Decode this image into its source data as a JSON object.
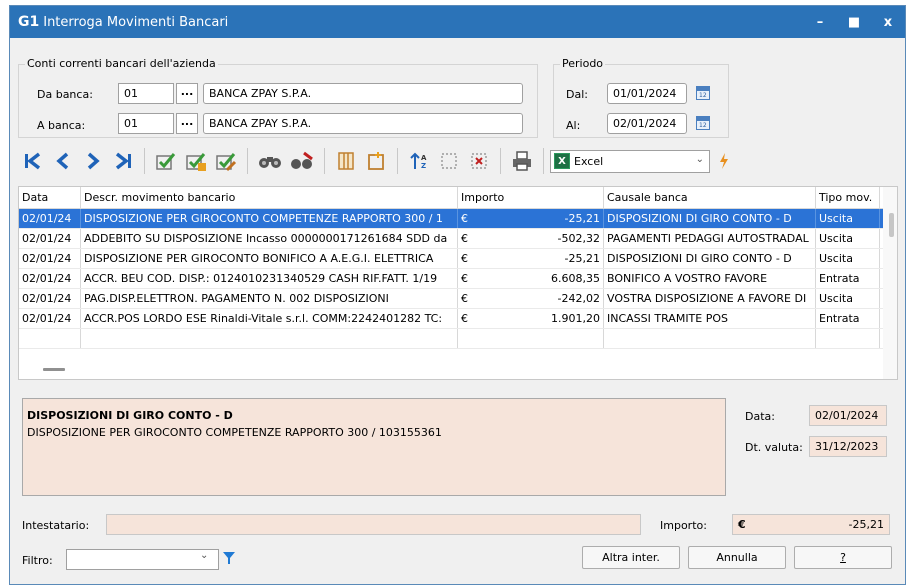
{
  "window": {
    "app_icon": "G1",
    "title": "Interroga Movimenti Bancari",
    "min": "–",
    "max": "■",
    "close": "x"
  },
  "conti": {
    "group_title": "Conti correnti bancari dell'azienda",
    "da_label": "Da banca:",
    "da_code": "01",
    "da_name": "BANCA ZPAY S.P.A.",
    "a_label": "A banca:",
    "a_code": "01",
    "a_name": "BANCA ZPAY S.P.A.",
    "dots": "..."
  },
  "periodo": {
    "group_title": "Periodo",
    "dal_label": "Dal:",
    "dal_value": "01/01/2024",
    "al_label": "Al:",
    "al_value": "02/01/2024",
    "cal_text": "12"
  },
  "toolbar": {
    "export_value": "Excel",
    "export_icon": "excel-icon"
  },
  "grid": {
    "columns": [
      "Data",
      "Descr. movimento bancario",
      "Importo",
      "Causale banca",
      "Tipo mov."
    ],
    "rows": [
      {
        "data": "02/01/24",
        "descr": "DISPOSIZIONE PER GIROCONTO COMPETENZE RAPPORTO 300 / 1",
        "cur": "€",
        "importo": "-25,21",
        "causale": "DISPOSIZIONI DI GIRO CONTO - D",
        "tipo": "Uscita"
      },
      {
        "data": "02/01/24",
        "descr": "ADDEBITO SU DISPOSIZIONE Incasso 0000000171261684 SDD da",
        "cur": "€",
        "importo": "-502,32",
        "causale": "PAGAMENTI PEDAGGI AUTOSTRADAL",
        "tipo": "Uscita"
      },
      {
        "data": "02/01/24",
        "descr": "DISPOSIZIONE PER GIROCONTO BONIFICO A A.E.G.I. ELETTRICA",
        "cur": "€",
        "importo": "-25,21",
        "causale": "DISPOSIZIONI DI GIRO CONTO - D",
        "tipo": "Uscita"
      },
      {
        "data": "02/01/24",
        "descr": "ACCR. BEU COD. DISP.: 0124010231340529 CASH RIF.FATT. 1/19",
        "cur": "€",
        "importo": "6.608,35",
        "causale": "BONIFICO A VOSTRO FAVORE",
        "tipo": "Entrata"
      },
      {
        "data": "02/01/24",
        "descr": "PAG.DISP.ELETTRON. PAGAMENTO N. 002 DISPOSIZIONI",
        "cur": "€",
        "importo": "-242,02",
        "causale": "VOSTRA DISPOSIZIONE A FAVORE DI",
        "tipo": "Uscita"
      },
      {
        "data": "02/01/24",
        "descr": "ACCR.POS LORDO ESE Rinaldi-Vitale s.r.l.  COMM:2242401282 TC:",
        "cur": "€",
        "importo": "1.901,20",
        "causale": "INCASSI TRAMITE POS",
        "tipo": "Entrata"
      }
    ]
  },
  "detail": {
    "title": "DISPOSIZIONI DI GIRO CONTO - D",
    "text": "DISPOSIZIONE PER GIROCONTO COMPETENZE RAPPORTO 300 / 103155361",
    "data_label": "Data:",
    "data_value": "02/01/2024",
    "valuta_label": "Dt. valuta:",
    "valuta_value": "31/12/2023"
  },
  "footer": {
    "intestatario_label": "Intestatario:",
    "intestatario_value": "",
    "importo_label": "Importo:",
    "importo_cur": "€",
    "importo_value": "-25,21",
    "filtro_label": "Filtro:",
    "filtro_value": "",
    "altra_label": "Altra inter.",
    "annulla_label": "Annulla",
    "help_label": "?"
  }
}
